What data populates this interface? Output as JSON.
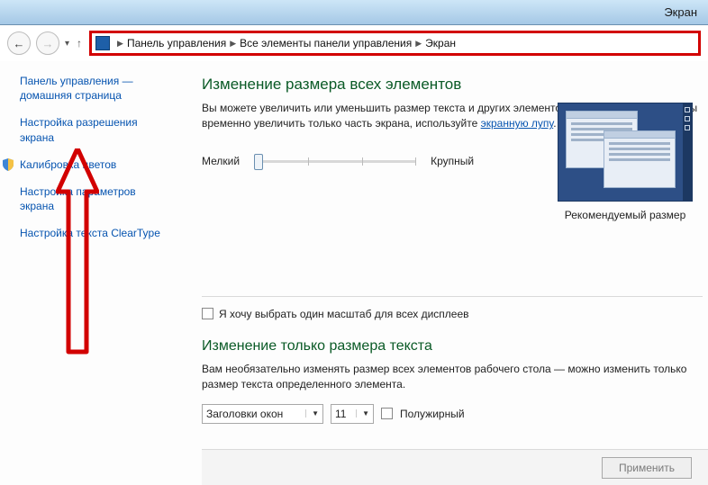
{
  "window": {
    "title": "Экран"
  },
  "breadcrumb": {
    "items": [
      "Панель управления",
      "Все элементы панели управления",
      "Экран"
    ]
  },
  "sidebar": {
    "items": [
      {
        "label": "Панель управления — домашняя страница"
      },
      {
        "label": "Настройка разрешения экрана"
      },
      {
        "label": "Калибровка цветов"
      },
      {
        "label": "Настройка параметров экрана"
      },
      {
        "label": "Настройка текста ClearType"
      }
    ]
  },
  "main": {
    "h1": "Изменение размера всех элементов",
    "intro_a": "Вы можете увеличить или уменьшить размер текста и других элементов на рабочем столе. Чтобы временно увеличить только часть экрана, используйте ",
    "intro_link": "экранную лупу",
    "intro_b": ".",
    "slider": {
      "min_label": "Мелкий",
      "max_label": "Крупный"
    },
    "reco_caption": "Рекомендуемый размер",
    "chk_label": "Я хочу выбрать один масштаб для всех дисплеев",
    "h2": "Изменение только размера текста",
    "p2": "Вам необязательно изменять размер всех элементов рабочего стола — можно изменить только размер текста определенного элемента.",
    "combo_element": "Заголовки окон",
    "combo_size": "11",
    "chk_bold": "Полужирный"
  },
  "footer": {
    "apply": "Применить"
  }
}
